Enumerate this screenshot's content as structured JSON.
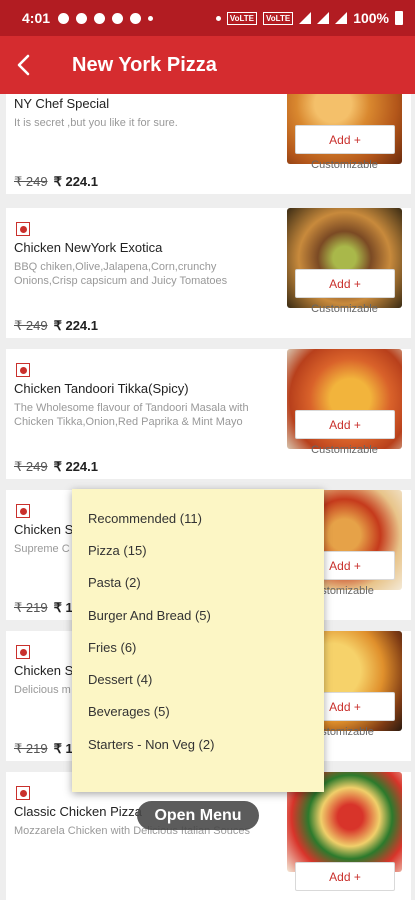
{
  "statusbar": {
    "time": "4:01",
    "battery": "100%"
  },
  "appbar": {
    "title": "New York Pizza"
  },
  "items": [
    {
      "name": "NY Chef Special",
      "desc": "It is secret ,but you like it for sure.",
      "old_price": "₹ 249",
      "new_price": "₹ 224.1",
      "add_label": "Add +",
      "custom_label": "Customizable"
    },
    {
      "name": "Chicken NewYork Exotica",
      "desc": "BBQ chiken,Olive,Jalapena,Corn,crunchy Onions,Crisp capsicum and Juicy Tomatoes",
      "old_price": "₹ 249",
      "new_price": "₹ 224.1",
      "add_label": "Add +",
      "custom_label": "Customizable"
    },
    {
      "name": "Chicken Tandoori Tikka(Spicy)",
      "desc": "The Wholesome flavour of Tandoori Masala with Chicken Tikka,Onion,Red Paprika & Mint Mayo",
      "old_price": "₹ 249",
      "new_price": "₹ 224.1",
      "add_label": "Add +",
      "custom_label": "Customizable"
    },
    {
      "name": "Chicken S",
      "desc": "Supreme C Olive , Toma chicken",
      "old_price": "₹ 219",
      "new_price": "₹ 1",
      "add_label": "Add +",
      "custom_label": "ustomizable"
    },
    {
      "name": "Chicken S",
      "desc": "Delicious m Awesome",
      "old_price": "₹ 219",
      "new_price": "₹ 1",
      "add_label": "Add +",
      "custom_label": "ustomizable"
    },
    {
      "name": "Classic Chicken Pizza",
      "desc": "Mozzarela Chicken with Delicious Italian Souces",
      "old_price": "",
      "new_price": "",
      "add_label": "Add +",
      "custom_label": ""
    }
  ],
  "menu": {
    "items": [
      "Recommended (11)",
      "Pizza (15)",
      "Pasta (2)",
      "Burger And Bread (5)",
      "Fries (6)",
      "Dessert (4)",
      "Beverages (5)",
      "Starters - Non Veg (2)"
    ]
  },
  "fab": {
    "label": "Open Menu"
  }
}
